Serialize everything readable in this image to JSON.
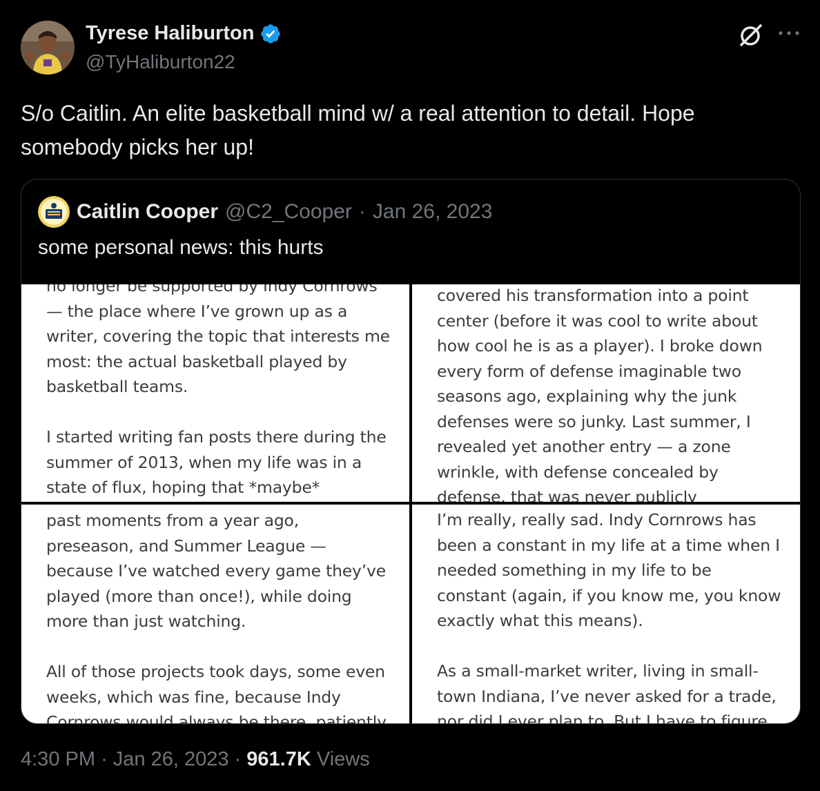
{
  "author": {
    "display_name": "Tyrese Haliburton",
    "handle": "@TyHaliburton22"
  },
  "tweet": {
    "text": "S/o Caitlin. An elite basketball mind w/ a real attention to detail. Hope somebody picks her up!"
  },
  "quote": {
    "display_name": "Caitlin Cooper",
    "handle": "@C2_Cooper",
    "separator": "·",
    "date": "Jan 26, 2023",
    "text": "some personal news: this hurts",
    "images": [
      {
        "lines": "no longer be supported by Indy Cornrows\n—  the place where I’ve grown up as a\nwriter, covering the topic that interests me\nmost: the actual basketball played by\nbasketball teams.\n\nI started writing fan posts there during the\nsummer of 2013, when my life was in a\nstate of flux, hoping that *maybe*\nsomebody would read about my basketball"
      },
      {
        "lines": "covered his transformation into a point\ncenter (before it was cool to write about\nhow cool he is as a player). I broke down\nevery form of defense imaginable two\nseasons ago, explaining why the junk\ndefenses were so junky. Last summer, I\nrevealed yet another entry — a zone\nwrinkle, with defense concealed by\ndefense, that was never publicly"
      },
      {
        "lines": "past moments from a year ago,\npreseason, and Summer League —\nbecause I’ve watched every game they’ve\nplayed (more than once!), while doing\nmore than just watching.\n\nAll of those projects took days, some even\nweeks, which was fine, because Indy\nCornrows would always be there, patiently"
      },
      {
        "lines": "I’m really, really sad. Indy Cornrows has\nbeen a constant in my life at a time when I\nneeded something in my life to be\nconstant (again, if you know me, you know\nexactly what this means).\n\nAs a small-market writer, living in small-\ntown Indiana, I’ve never asked for a trade,\nnor did I ever plan to. But I have to figure"
      }
    ]
  },
  "footer": {
    "time": "4:30 PM",
    "separator": "·",
    "date": "Jan 26, 2023",
    "views_count": "961.7K",
    "views_label": "Views"
  },
  "colors": {
    "background": "#000000",
    "text": "#e7e9ea",
    "secondary": "#71767b",
    "verified": "#1d9bf0",
    "border": "#2f3336"
  },
  "icons": [
    "verified-badge-icon",
    "grok-icon",
    "more-options-icon"
  ]
}
